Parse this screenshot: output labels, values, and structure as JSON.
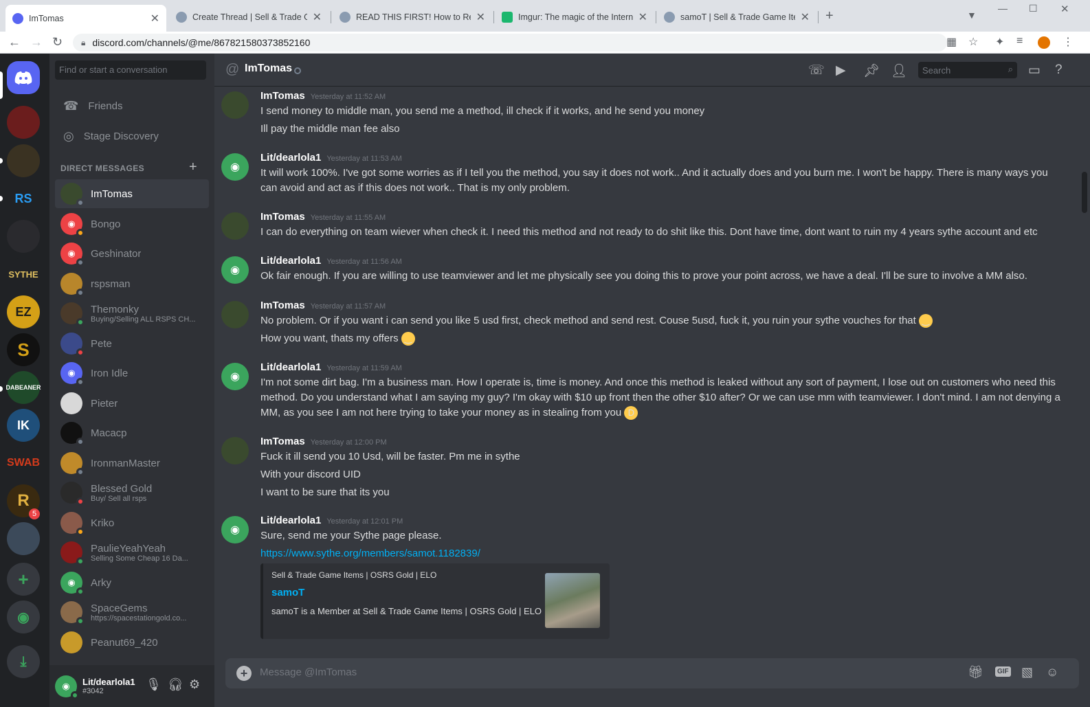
{
  "browser": {
    "tabs": [
      {
        "title": "ImTomas"
      },
      {
        "title": "Create Thread | Sell & Trade Gam"
      },
      {
        "title": "READ THIS FIRST! How to Report"
      },
      {
        "title": "Imgur: The magic of the Internet"
      },
      {
        "title": "samoT | Sell & Trade Game Items"
      }
    ],
    "url": "discord.com/channels/@me/867821580373852160"
  },
  "sidebar": {
    "search_placeholder": "Find or start a conversation",
    "friends_label": "Friends",
    "stage_label": "Stage Discovery",
    "dm_header": "DIRECT MESSAGES",
    "dms": [
      {
        "name": "ImTomas",
        "sub": ""
      },
      {
        "name": "Bongo",
        "sub": ""
      },
      {
        "name": "Geshinator",
        "sub": ""
      },
      {
        "name": "rspsman",
        "sub": ""
      },
      {
        "name": "Themonky",
        "sub": "Buying/Selling ALL RSPS CH..."
      },
      {
        "name": "Pete",
        "sub": ""
      },
      {
        "name": "Iron Idle",
        "sub": ""
      },
      {
        "name": "Pieter",
        "sub": ""
      },
      {
        "name": "Macacp",
        "sub": ""
      },
      {
        "name": "IronmanMaster",
        "sub": ""
      },
      {
        "name": "Blessed Gold",
        "sub": "Buy/ Sell all rsps"
      },
      {
        "name": "Kriko",
        "sub": ""
      },
      {
        "name": "PaulieYeahYeah",
        "sub": "Selling Some Cheap 16 Da..."
      },
      {
        "name": "Arky",
        "sub": ""
      },
      {
        "name": "SpaceGems",
        "sub": "https://spacestationgold.co..."
      },
      {
        "name": "Peanut69_420",
        "sub": ""
      }
    ]
  },
  "guild_badge": "5",
  "user": {
    "name": "Lit/dearlola1",
    "tag": "#3042"
  },
  "channel": {
    "name": "ImTomas",
    "search_placeholder": "Search",
    "composer_placeholder": "Message @ImTomas",
    "gif_label": "GIF"
  },
  "messages": [
    {
      "author": "ImTomas",
      "time": "Yesterday at 11:52 AM",
      "lines": [
        "I send money to middle man, you send me a method, ill check if it works, and he send you money",
        "Ill pay the middle man fee also"
      ]
    },
    {
      "author": "Lit/dearlola1",
      "time": "Yesterday at 11:53 AM",
      "lines": [
        "It will work 100%. I've got some worries as if I tell you the method, you say it does not work.. And it actually does and you burn me. I won't be happy. There is many ways you can avoid and act as if this does not work.. That is my only problem."
      ]
    },
    {
      "author": "ImTomas",
      "time": "Yesterday at 11:55 AM",
      "lines": [
        "I can do everything on team wiever when check it. I need this method and not ready to do shit like this. Dont have time, dont want to ruin my 4 years sythe account and etc"
      ]
    },
    {
      "author": "Lit/dearlola1",
      "time": "Yesterday at 11:56 AM",
      "lines": [
        "Ok fair enough. If you are willing to use teamviewer and let me physically see you doing this to prove your point across, we have a deal. I'll be sure to involve a MM also."
      ]
    },
    {
      "author": "ImTomas",
      "time": "Yesterday at 11:57 AM",
      "lines": [
        "No problem. Or if you want i can send you like 5 usd first, check method and send rest. Couse 5usd, fuck it, you ruin your sythe vouches for that",
        "How you want, thats my offers"
      ]
    },
    {
      "author": "Lit/dearlola1",
      "time": "Yesterday at 11:59 AM",
      "lines": [
        "I'm not some dirt bag. I'm a business man. How I operate is, time is money. And once this method is leaked without any sort of payment, I lose out on customers who need this method. Do you understand what I am saying my guy? I'm okay with $10 up front then the other $10 after? Or we can use mm with teamviewer. I don't mind. I am not denying a MM, as you see I am not here trying to take your money as in stealing from you"
      ]
    },
    {
      "author": "ImTomas",
      "time": "Yesterday at 12:00 PM",
      "lines": [
        "Fuck it ill send you 10 Usd, will be faster. Pm me in sythe",
        "With your discord UID",
        "I want to be sure that its you"
      ]
    },
    {
      "author": "Lit/dearlola1",
      "time": "Yesterday at 12:01 PM",
      "lines": [
        "Sure, send me your Sythe page please."
      ],
      "link": "https://www.sythe.org/members/samot.1182839/"
    }
  ],
  "embed": {
    "provider": "Sell & Trade Game Items | OSRS Gold | ELO",
    "title": "samoT",
    "description": "samoT is a Member at Sell & Trade Game Items | OSRS Gold | ELO"
  },
  "colors": {
    "blurple": "#5865f2",
    "green": "#3ba55d",
    "link": "#00b0f4",
    "online": "#3ba55d",
    "dnd": "#ed4245",
    "idle": "#faa61a"
  }
}
